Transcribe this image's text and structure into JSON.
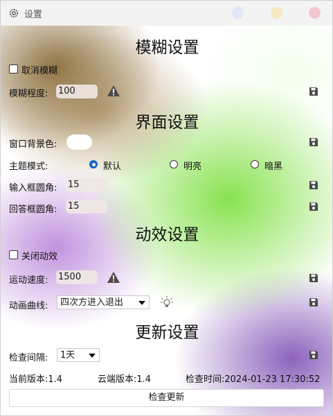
{
  "window": {
    "title": "设置",
    "controls": {
      "min_color": "#dfe6f5",
      "max_color": "#f6e8bf",
      "close_color": "#f6c6cf"
    }
  },
  "blur": {
    "heading": "模糊设置",
    "cancel_label": "取消模糊",
    "cancel_checked": false,
    "level_label": "模糊程度:",
    "level_value": "100"
  },
  "ui": {
    "heading": "界面设置",
    "bg_color_label": "窗口背景色:",
    "bg_color_value": "#ffffff",
    "theme_label": "主题模式:",
    "theme_options": [
      "默认",
      "明亮",
      "暗黑"
    ],
    "theme_selected": "默认",
    "input_radius_label": "输入框圆角:",
    "input_radius_value": "15",
    "answer_radius_label": "回答框圆角:",
    "answer_radius_value": "15"
  },
  "animation": {
    "heading": "动效设置",
    "disable_label": "关闭动效",
    "disable_checked": false,
    "speed_label": "运动速度:",
    "speed_value": "1500",
    "curve_label": "动画曲线:",
    "curve_value": "四次方进入退出"
  },
  "update": {
    "heading": "更新设置",
    "interval_label": "检查间隔:",
    "interval_value": "1天",
    "current_version": "当前版本:1.4",
    "cloud_version": "云端版本:1.4",
    "check_time": "检查时间:2024-01-23 17:30:52",
    "check_button": "检查更新"
  },
  "colors": {
    "accent": "#1565c0",
    "warning": "#4a4a4a"
  }
}
